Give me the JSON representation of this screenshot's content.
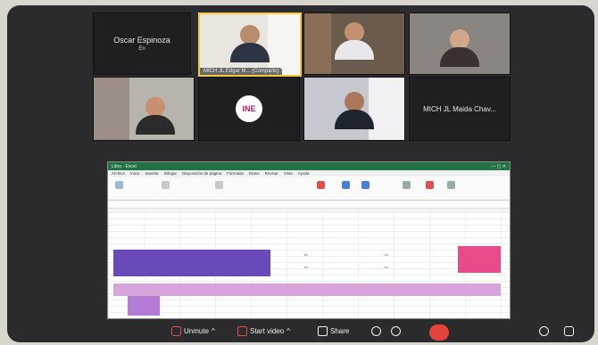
{
  "participants": [
    {
      "id": "oscar",
      "name": "Oscar Espinoza",
      "sub": "En"
    },
    {
      "id": "edgar",
      "name": "MICH JL Edgar M... (Compartir)",
      "active": true
    },
    {
      "id": "p3",
      "name": ""
    },
    {
      "id": "p4",
      "name": ""
    },
    {
      "id": "p5",
      "name": ""
    },
    {
      "id": "ine",
      "name": ""
    },
    {
      "id": "p7",
      "name": ""
    },
    {
      "id": "maida",
      "name": "MICH JL Maida Chav..."
    }
  ],
  "share": {
    "app_title": "Libro - Excel",
    "menu": [
      "Archivo",
      "Inicio",
      "Insertar",
      "Dibujar",
      "Disposición de página",
      "Fórmulas",
      "Datos",
      "Revisar",
      "Vista",
      "Ayuda"
    ]
  },
  "toolbar": {
    "unmute": "Unmute",
    "start_video": "Start video",
    "share": "Share"
  },
  "colors": {
    "accent": "#217346",
    "end": "#e0443a",
    "purple": "#6a4ab8",
    "pink": "#e84a8a"
  }
}
